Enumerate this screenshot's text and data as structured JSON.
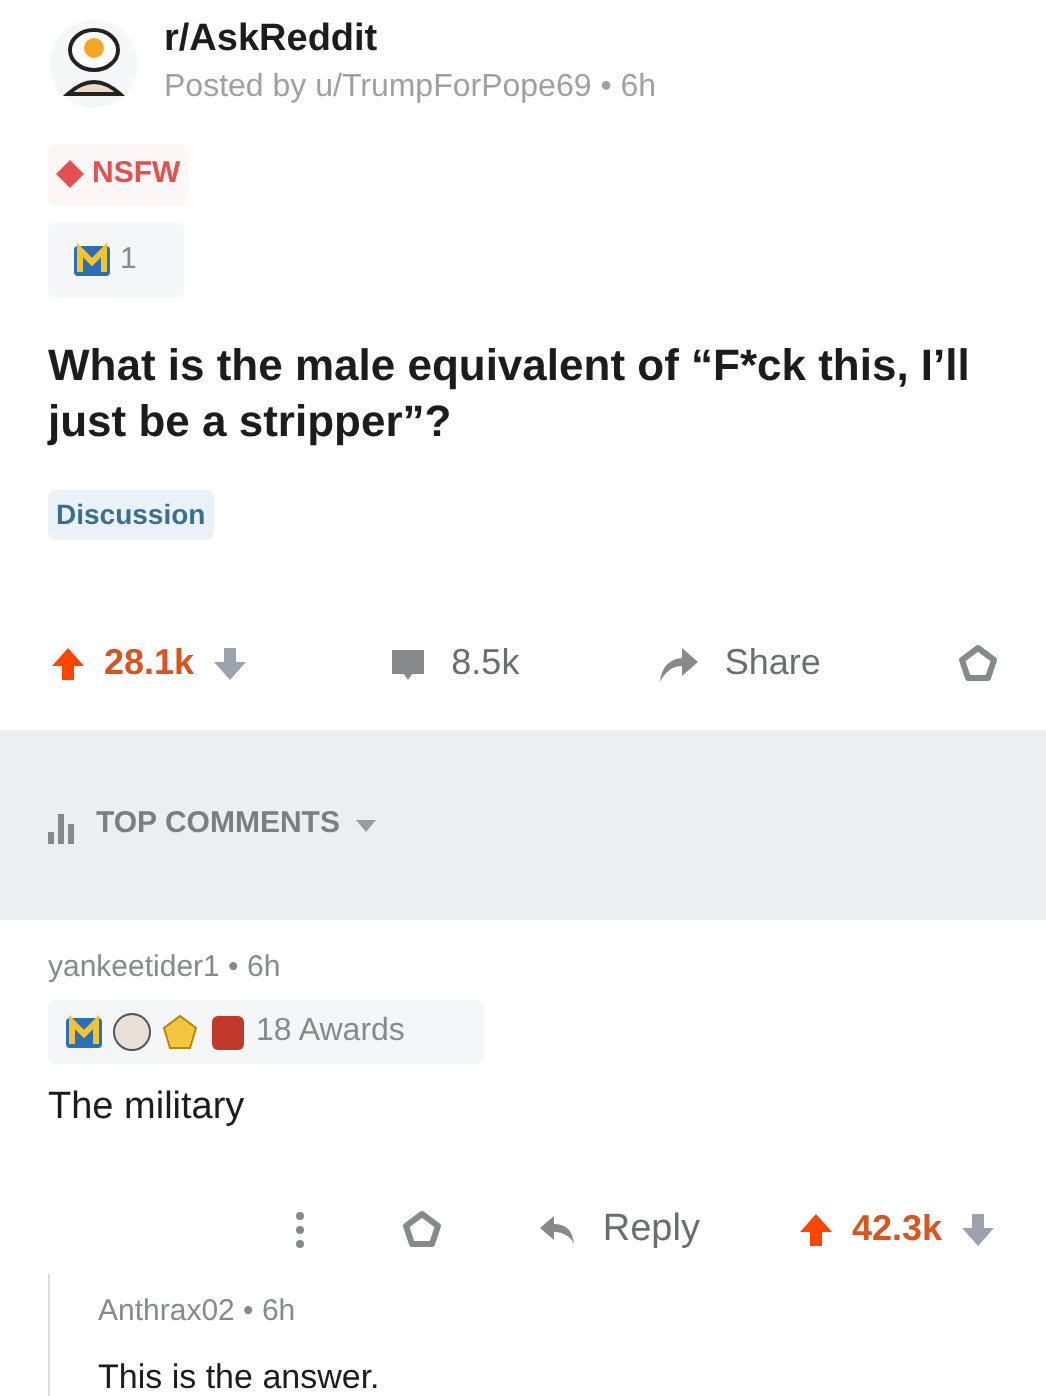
{
  "post": {
    "subreddit": "r/AskReddit",
    "posted_by": "Posted by u/TrumpForPope69 • 6h",
    "nsfw_label": "NSFW",
    "award_count": "1",
    "title": "What is the male equivalent of “F*ck this, I’ll just be a stripper”?",
    "flair": "Discussion",
    "score": "28.1k",
    "upvoted": true,
    "comments": "8.5k",
    "share": "Share"
  },
  "sort": {
    "label": "TOP COMMENTS"
  },
  "comments": [
    {
      "author": "yankeetider1 • 6h",
      "awards": "18 Awards",
      "body": "The military",
      "reply": "Reply",
      "score": "42.3k",
      "upvoted": true,
      "replies": [
        {
          "author": "Anthrax02 • 6h",
          "body": "This is the answer."
        }
      ]
    }
  ]
}
